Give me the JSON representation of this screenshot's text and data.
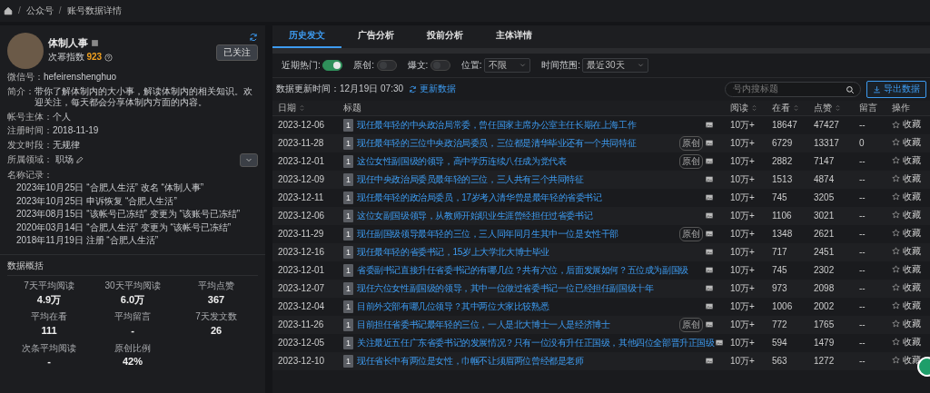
{
  "breadcrumb": [
    "公众号",
    "账号数据详情"
  ],
  "breadcrumb_separator": "/",
  "profile": {
    "name": "体制人事",
    "index_label": "次幂指数",
    "index_value": "923",
    "follow_button": "已关注",
    "fields": [
      {
        "label": "微信号：",
        "value": "hefeirenshenghuo"
      },
      {
        "label": "简介：",
        "value": "带你了解体制内的大小事，解读体制内的相关知识。欢迎关注，每天都会分享体制内方面的内容。"
      },
      {
        "label": "帐号主体：",
        "value": "个人"
      },
      {
        "label": "注册时间：",
        "value": "2018-11-19"
      },
      {
        "label": "发文时段：",
        "value": "无规律"
      },
      {
        "label": "所属领域：",
        "value": "职场",
        "kind": "editable"
      }
    ],
    "records_label": "名称记录：",
    "records": [
      "2023年10月25日 “合肥人生活” 改名 “体制人事”",
      "2023年10月25日 申诉恢复 “合肥人生活”",
      "2023年08月15日 “该帐号已冻结” 变更为 “该账号已冻结”",
      "2020年03月14日 “合肥人生活” 变更为 “该帐号已冻结”",
      "2018年11月19日 注册 “合肥人生活”"
    ]
  },
  "overview": {
    "title": "数据概括",
    "stats": [
      {
        "label": "7天平均阅读",
        "value": "4.9万"
      },
      {
        "label": "30天平均阅读",
        "value": "6.0万"
      },
      {
        "label": "平均点赞",
        "value": "367"
      },
      {
        "label": "平均在看",
        "value": "111"
      },
      {
        "label": "平均留言",
        "value": "-"
      },
      {
        "label": "7天发文数",
        "value": "26"
      },
      {
        "label": "次条平均阅读",
        "value": "-"
      },
      {
        "label": "原创比例",
        "value": "42%"
      }
    ]
  },
  "tabs": [
    {
      "label": "历史发文",
      "selected": true
    },
    {
      "label": "广告分析",
      "selected": false
    },
    {
      "label": "投前分析",
      "selected": false
    },
    {
      "label": "主体详情",
      "selected": false
    }
  ],
  "filters": [
    {
      "kind": "toggle",
      "label": "近期热门:",
      "on": true
    },
    {
      "kind": "toggle",
      "label": "原创:",
      "on": false
    },
    {
      "kind": "toggle",
      "label": "爆文:",
      "on": false
    },
    {
      "kind": "select",
      "label": "位置:",
      "value": "不限"
    },
    {
      "kind": "select",
      "label": "时间范围:",
      "value": "最近30天"
    }
  ],
  "update_time": "数据更新时间：12月19日 07:30",
  "refresh_link": "更新数据",
  "search": {
    "placeholder": "号内搜标题"
  },
  "export_button": "导出数据",
  "table": {
    "columns": [
      {
        "label": "日期",
        "sortable": true
      },
      {
        "label": "标题",
        "sortable": false
      },
      {
        "label": "阅读",
        "sortable": true
      },
      {
        "label": "在看",
        "sortable": true
      },
      {
        "label": "点赞",
        "sortable": true
      },
      {
        "label": "留言",
        "sortable": false
      },
      {
        "label": "操作",
        "sortable": false
      }
    ],
    "rows": [
      {
        "date": "2023-12-06",
        "rank": "1",
        "title": "现任最年轻的中央政治局常委，曾任国家主席办公室主任长期在上海工作",
        "reads": "10万+",
        "watching": "18647",
        "likes": "47427",
        "comments": "--",
        "action": "收藏"
      },
      {
        "date": "2023-11-28",
        "rank": "1",
        "title": "现任最年轻的三位中央政治局委员，三位都是清华毕业还有一个共同特征",
        "badge": "原创",
        "reads": "10万+",
        "watching": "6729",
        "likes": "13317",
        "comments": "0",
        "action": "收藏"
      },
      {
        "date": "2023-12-01",
        "rank": "1",
        "title": "这位女性副国级的领导，高中学历连续八任成为党代表",
        "badge": "原创",
        "reads": "10万+",
        "watching": "2882",
        "likes": "7147",
        "comments": "--",
        "action": "收藏"
      },
      {
        "date": "2023-12-09",
        "rank": "1",
        "title": "现任中央政治局委员最年轻的三位，三人共有三个共同特征",
        "reads": "10万+",
        "watching": "1513",
        "likes": "4874",
        "comments": "--",
        "action": "收藏"
      },
      {
        "date": "2023-12-11",
        "rank": "1",
        "title": "现任最年轻的政治局委员，17岁考入清华曾是最年轻的省委书记",
        "reads": "10万+",
        "watching": "745",
        "likes": "3205",
        "comments": "--",
        "action": "收藏"
      },
      {
        "date": "2023-12-06",
        "rank": "1",
        "title": "这位女副国级领导，从教师开始职业生涯曾经担任过省委书记",
        "reads": "10万+",
        "watching": "1106",
        "likes": "3021",
        "comments": "--",
        "action": "收藏"
      },
      {
        "date": "2023-11-29",
        "rank": "1",
        "title": "现任副国级领导最年轻的三位，三人同年同月生其中一位是女性干部",
        "badge": "原创",
        "reads": "10万+",
        "watching": "1348",
        "likes": "2621",
        "comments": "--",
        "action": "收藏"
      },
      {
        "date": "2023-12-16",
        "rank": "1",
        "title": "现任最年轻的省委书记，15岁上大学北大博士毕业",
        "reads": "10万+",
        "watching": "717",
        "likes": "2451",
        "comments": "--",
        "action": "收藏"
      },
      {
        "date": "2023-12-01",
        "rank": "1",
        "title": "省委副书记直接升任省委书记的有哪几位？共有六位，后面发展如何？五位成为副国级",
        "reads": "10万+",
        "watching": "745",
        "likes": "2302",
        "comments": "--",
        "action": "收藏"
      },
      {
        "date": "2023-12-07",
        "rank": "1",
        "title": "现任六位女性副国级的领导，其中一位做过省委书记一位已经担任副国级十年",
        "reads": "10万+",
        "watching": "973",
        "likes": "2098",
        "comments": "--",
        "action": "收藏"
      },
      {
        "date": "2023-12-04",
        "rank": "1",
        "title": "目前外交部有哪几位领导？其中两位大家比较熟悉",
        "reads": "10万+",
        "watching": "1006",
        "likes": "2002",
        "comments": "--",
        "action": "收藏"
      },
      {
        "date": "2023-11-26",
        "rank": "1",
        "title": "目前担任省委书记最年轻的三位，一人是北大博士一人是经济博士",
        "badge": "原创",
        "reads": "10万+",
        "watching": "772",
        "likes": "1765",
        "comments": "--",
        "action": "收藏"
      },
      {
        "date": "2023-12-05",
        "rank": "1",
        "title": "关注最近五任广东省委书记的发展情况？只有一位没有升任正国级，其他四位全部晋升正国级",
        "reads": "10万+",
        "watching": "594",
        "likes": "1479",
        "comments": "--",
        "action": "收藏"
      },
      {
        "date": "2023-12-10",
        "rank": "1",
        "title": "现任省长中有两位是女性，巾帼不让须眉两位曾经都是老师",
        "reads": "10万+",
        "watching": "563",
        "likes": "1272",
        "comments": "--",
        "action": "收藏"
      }
    ]
  }
}
